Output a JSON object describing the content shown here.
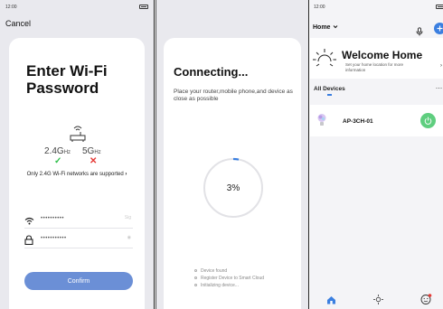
{
  "status": {
    "time": "12:00"
  },
  "wifi_screen": {
    "cancel_label": "Cancel",
    "title": "Enter Wi-Fi Password",
    "band_24": "2.4G",
    "band_24_unit": "Hz",
    "band_5": "5G",
    "band_5_unit": "Hz",
    "band_24_mark": "✓",
    "band_5_mark": "✕",
    "note": "Only 2.4G Wi-Fi networks are supported",
    "note_chevron": "›",
    "ssid_value": "••••••••••",
    "ssid_hint": "Sig",
    "password_value": "•••••••••••",
    "password_hint": "◉",
    "confirm_label": "Confirm",
    "colors": {
      "accent": "#6b8fd6",
      "check": "#2fbf4a",
      "cross": "#e53935"
    },
    "icons": [
      "router-icon",
      "wifi-icon",
      "lock-icon",
      "check-icon",
      "cross-icon"
    ]
  },
  "connecting_screen": {
    "title": "Connecting...",
    "description": "Place your router,mobile phone,and device as close as possible",
    "progress_label": "3%",
    "progress": 0.03,
    "steps": [
      "Device found",
      "Register Device to Smart Cloud",
      "Initializing device..."
    ]
  },
  "home_screen": {
    "home_selector": "Home",
    "welcome_title": "Welcome Home",
    "welcome_subtitle": "Set your home location for more information",
    "all_devices_label": "All Devices",
    "more_label": "···",
    "device_name": "AP-3CH-01",
    "colors": {
      "power": "#5fce7f",
      "accent": "#3b7fe0"
    },
    "icons": [
      "chevron-down-icon",
      "mic-icon",
      "add-icon",
      "sun-icon",
      "bulb-icon",
      "power-icon",
      "home-tab-icon",
      "scene-tab-icon",
      "profile-tab-icon"
    ]
  }
}
